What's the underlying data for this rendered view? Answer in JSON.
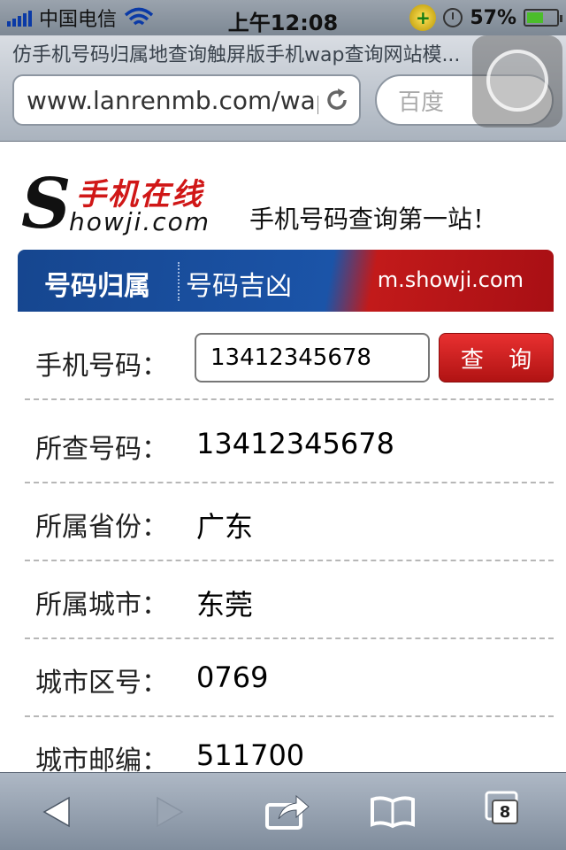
{
  "status_bar": {
    "carrier": "中国电信",
    "time": "上午12:08",
    "battery_percent": "57%",
    "battery_level": 0.57
  },
  "browser": {
    "page_title": "仿手机号码归属地查询触屏版手机wap查询网站模...",
    "url": "www.lanrenmb.com/wap",
    "search_placeholder": "百度",
    "tabs_count": "8"
  },
  "site": {
    "logo_cn": "手机在线",
    "logo_en": "howji.com",
    "logo_s": "S",
    "slogan": "手机号码查询第一站！",
    "nav": {
      "tab_active": "号码归属",
      "tab_other": "号码吉凶",
      "site_url": "m.showji.com"
    }
  },
  "form": {
    "phone_label": "手机号码：",
    "phone_value": "13412345678",
    "query_button": "查 询"
  },
  "results": [
    {
      "label": "所查号码：",
      "value": "13412345678"
    },
    {
      "label": "所属省份：",
      "value": "广东"
    },
    {
      "label": "所属城市：",
      "value": "东莞"
    },
    {
      "label": "城市区号：",
      "value": "0769"
    },
    {
      "label": "城市邮编：",
      "value": "511700"
    }
  ],
  "colors": {
    "nav_blue": "#1b54a8",
    "nav_red": "#c21a1a",
    "button_red": "#d02020",
    "logo_red": "#d01717"
  }
}
